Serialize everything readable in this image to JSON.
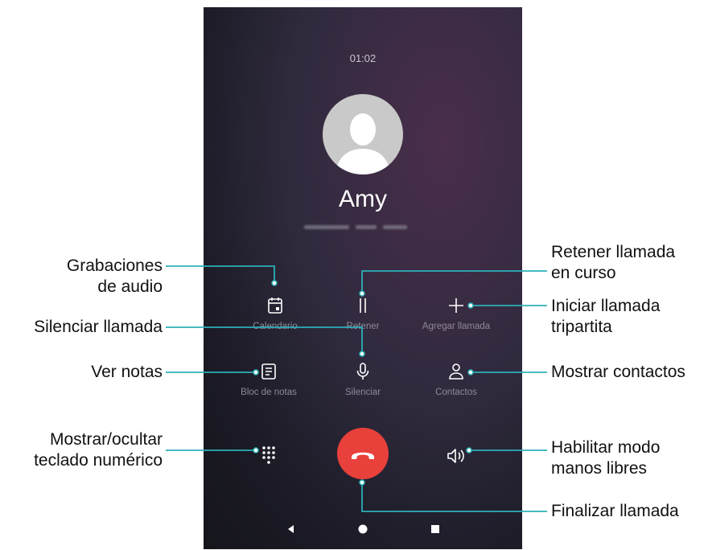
{
  "call_screen": {
    "duration": "01:02",
    "contact_name": "Amy",
    "actions": {
      "calendar_label": "Calendario",
      "hold_label": "Retener",
      "add_call_label": "Agregar llamada",
      "notes_label": "Bloc de notas",
      "mute_label": "Silenciar",
      "contacts_label": "Contactos"
    }
  },
  "callouts": {
    "recordings": "Grabaciones\nde audio",
    "mute": "Silenciar llamada",
    "notes": "Ver notas",
    "dialpad": "Mostrar/ocultar\nteclado numérico",
    "hold": "Retener llamada\nen curso",
    "add_call": "Iniciar llamada\ntripartita",
    "contacts": "Mostrar contactos",
    "speaker": "Habilitar modo\nmanos libres",
    "end_call": "Finalizar llamada"
  },
  "colors": {
    "callout_line": "#2bb0b8",
    "end_call": "#e8403b"
  }
}
